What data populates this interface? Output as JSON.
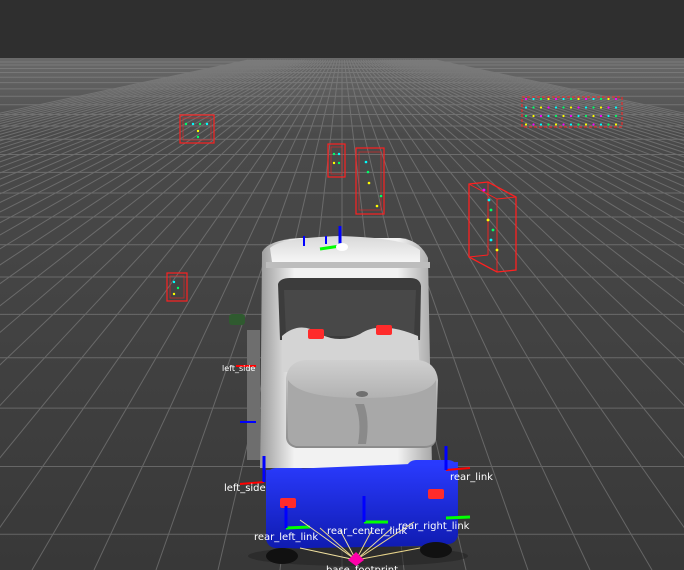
{
  "frame_labels": {
    "left_side_upper": "left_side",
    "left_side_lower": "left_side",
    "rear_link": "rear_link",
    "rear_center_link": "rear_center_link",
    "rear_left_link": "rear_left_link",
    "rear_right_link": "rear_right_link",
    "base_footprint": "base_footprint"
  },
  "colors": {
    "background": "#303030",
    "grid": "#8a8a8a",
    "bounding_box": "#ff2020",
    "vehicle_body": "#e8e8e8",
    "vehicle_base": "#1a2cff",
    "axis_x": "#ff0000",
    "axis_y": "#00ff00",
    "axis_z": "#0000ff"
  },
  "icons": [
    "bounding-box-marker",
    "tf-axes-marker",
    "vehicle-model"
  ]
}
